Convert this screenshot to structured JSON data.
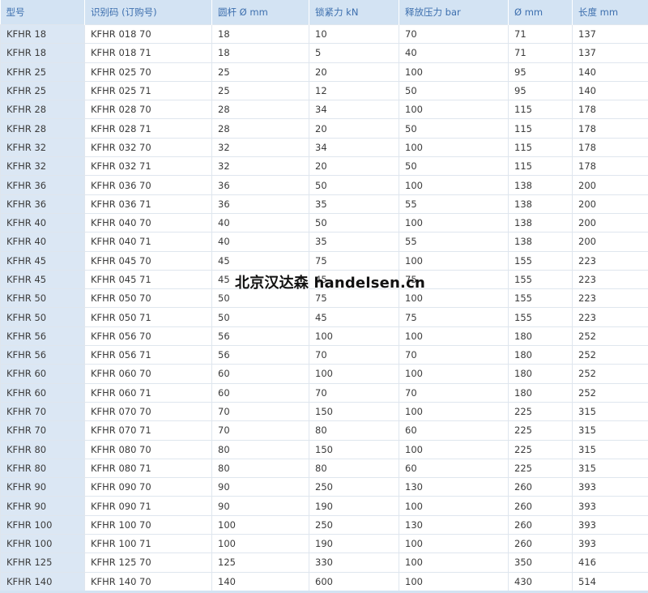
{
  "table": {
    "headers": [
      "型号",
      "识别码 (订购号)",
      "圆杆 Ø mm",
      "锁紧力 kN",
      "释放压力 bar",
      "Ø mm",
      "长度 mm"
    ],
    "rows": [
      [
        "KFHR 18",
        "KFHR 018 70",
        "18",
        "10",
        "70",
        "71",
        "137"
      ],
      [
        "KFHR 18",
        "KFHR 018 71",
        "18",
        "5",
        "40",
        "71",
        "137"
      ],
      [
        "KFHR 25",
        "KFHR 025 70",
        "25",
        "20",
        "100",
        "95",
        "140"
      ],
      [
        "KFHR 25",
        "KFHR 025 71",
        "25",
        "12",
        "50",
        "95",
        "140"
      ],
      [
        "KFHR 28",
        "KFHR 028 70",
        "28",
        "34",
        "100",
        "115",
        "178"
      ],
      [
        "KFHR 28",
        "KFHR 028 71",
        "28",
        "20",
        "50",
        "115",
        "178"
      ],
      [
        "KFHR 32",
        "KFHR 032 70",
        "32",
        "34",
        "100",
        "115",
        "178"
      ],
      [
        "KFHR 32",
        "KFHR 032 71",
        "32",
        "20",
        "50",
        "115",
        "178"
      ],
      [
        "KFHR 36",
        "KFHR 036 70",
        "36",
        "50",
        "100",
        "138",
        "200"
      ],
      [
        "KFHR 36",
        "KFHR 036 71",
        "36",
        "35",
        "55",
        "138",
        "200"
      ],
      [
        "KFHR 40",
        "KFHR 040 70",
        "40",
        "50",
        "100",
        "138",
        "200"
      ],
      [
        "KFHR 40",
        "KFHR 040 71",
        "40",
        "35",
        "55",
        "138",
        "200"
      ],
      [
        "KFHR 45",
        "KFHR 045 70",
        "45",
        "75",
        "100",
        "155",
        "223"
      ],
      [
        "KFHR 45",
        "KFHR 045 71",
        "45",
        "45",
        "75",
        "155",
        "223"
      ],
      [
        "KFHR 50",
        "KFHR 050 70",
        "50",
        "75",
        "100",
        "155",
        "223"
      ],
      [
        "KFHR 50",
        "KFHR 050 71",
        "50",
        "45",
        "75",
        "155",
        "223"
      ],
      [
        "KFHR 56",
        "KFHR 056 70",
        "56",
        "100",
        "100",
        "180",
        "252"
      ],
      [
        "KFHR 56",
        "KFHR 056 71",
        "56",
        "70",
        "70",
        "180",
        "252"
      ],
      [
        "KFHR 60",
        "KFHR 060 70",
        "60",
        "100",
        "100",
        "180",
        "252"
      ],
      [
        "KFHR 60",
        "KFHR 060 71",
        "60",
        "70",
        "70",
        "180",
        "252"
      ],
      [
        "KFHR 70",
        "KFHR 070 70",
        "70",
        "150",
        "100",
        "225",
        "315"
      ],
      [
        "KFHR 70",
        "KFHR 070 71",
        "70",
        "80",
        "60",
        "225",
        "315"
      ],
      [
        "KFHR 80",
        "KFHR 080 70",
        "80",
        "150",
        "100",
        "225",
        "315"
      ],
      [
        "KFHR 80",
        "KFHR 080 71",
        "80",
        "80",
        "60",
        "225",
        "315"
      ],
      [
        "KFHR 90",
        "KFHR 090 70",
        "90",
        "250",
        "130",
        "260",
        "393"
      ],
      [
        "KFHR 90",
        "KFHR 090 71",
        "90",
        "190",
        "100",
        "260",
        "393"
      ],
      [
        "KFHR 100",
        "KFHR 100 70",
        "100",
        "250",
        "130",
        "260",
        "393"
      ],
      [
        "KFHR 100",
        "KFHR 100 71",
        "100",
        "190",
        "100",
        "260",
        "393"
      ],
      [
        "KFHR 125",
        "KFHR 125 70",
        "125",
        "330",
        "100",
        "350",
        "416"
      ],
      [
        "KFHR 140",
        "KFHR 140 70",
        "140",
        "600",
        "100",
        "430",
        "514"
      ]
    ]
  },
  "watermark": {
    "text": "北京汉达森 handelsen.cn"
  },
  "colors": {
    "header_bg": "#d3e3f3",
    "header_text": "#3d6fae",
    "model_col_bg": "#dbe7f4",
    "border": "#dfe6ee"
  }
}
